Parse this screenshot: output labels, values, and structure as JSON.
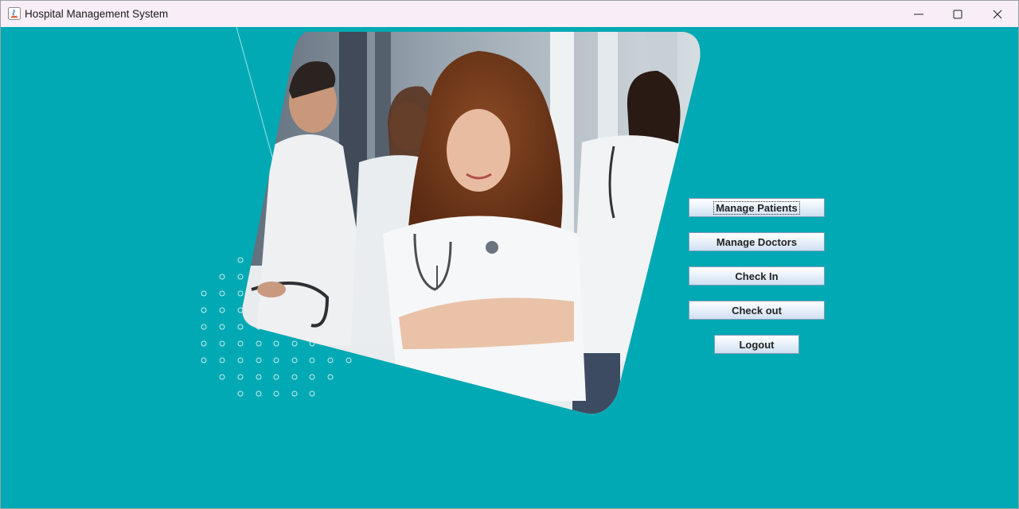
{
  "window": {
    "title": "Hospital Management System",
    "icons": {
      "app": "java-app-icon",
      "minimize": "minimize-icon",
      "maximize": "maximize-icon",
      "close": "close-icon"
    }
  },
  "colors": {
    "background": "#00a9b3",
    "titlebar": "#f7eef7",
    "button_border": "#7f9db9"
  },
  "menu": {
    "manage_patients": "Manage Patients",
    "manage_doctors": "Manage Doctors",
    "check_in": "Check In",
    "check_out": "Check out",
    "logout": "Logout"
  },
  "image": {
    "subject": "doctors-group-photo"
  }
}
